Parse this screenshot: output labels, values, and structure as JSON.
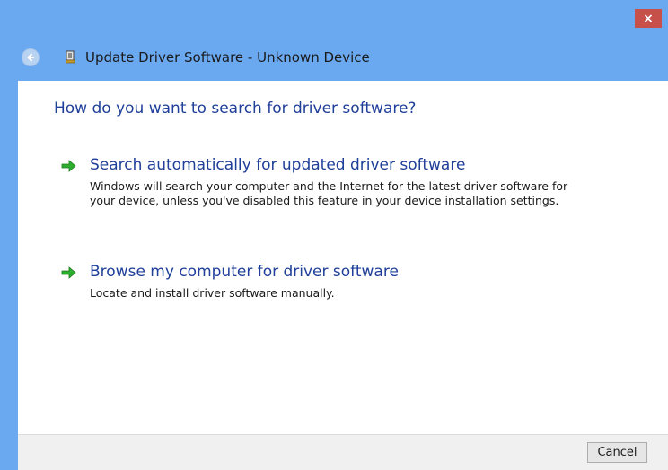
{
  "window": {
    "title": "Update Driver Software - Unknown Device",
    "close_label": "×"
  },
  "main": {
    "question": "How do you want to search for driver software?",
    "options": [
      {
        "title": "Search automatically for updated driver software",
        "description": "Windows will search your computer and the Internet for the latest driver software for your device, unless you've disabled this feature in your device installation settings."
      },
      {
        "title": "Browse my computer for driver software",
        "description": "Locate and install driver software manually."
      }
    ]
  },
  "footer": {
    "cancel_label": "Cancel"
  },
  "colors": {
    "frame": "#6aa8f0",
    "close": "#c7504a",
    "link_text": "#1f3f99",
    "arrow": "#2eae2e"
  },
  "icons": {
    "back": "back-arrow-icon",
    "device": "device-icon",
    "option": "green-arrow-icon",
    "close": "close-icon"
  }
}
